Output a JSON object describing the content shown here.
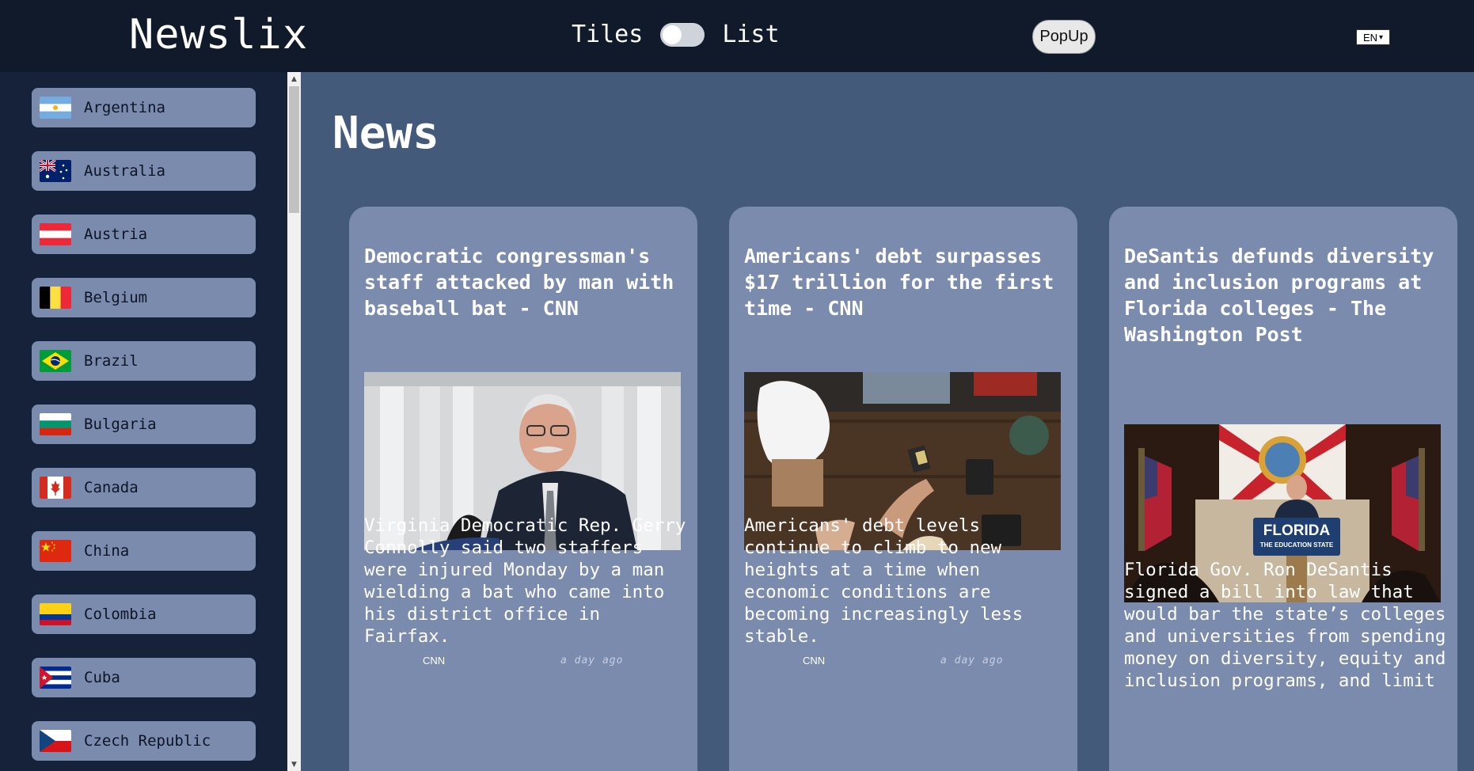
{
  "header": {
    "logo": "Newslix",
    "view_tiles": "Tiles",
    "view_list": "List",
    "popup_label": "PopUp",
    "language": "EN"
  },
  "sidebar": {
    "countries": [
      {
        "label": "Argentina",
        "flag_icon": "flag-argentina-icon"
      },
      {
        "label": "Australia",
        "flag_icon": "flag-australia-icon"
      },
      {
        "label": "Austria",
        "flag_icon": "flag-austria-icon"
      },
      {
        "label": "Belgium",
        "flag_icon": "flag-belgium-icon"
      },
      {
        "label": "Brazil",
        "flag_icon": "flag-brazil-icon"
      },
      {
        "label": "Bulgaria",
        "flag_icon": "flag-bulgaria-icon"
      },
      {
        "label": "Canada",
        "flag_icon": "flag-canada-icon"
      },
      {
        "label": "China",
        "flag_icon": "flag-china-icon"
      },
      {
        "label": "Colombia",
        "flag_icon": "flag-colombia-icon"
      },
      {
        "label": "Cuba",
        "flag_icon": "flag-cuba-icon"
      },
      {
        "label": "Czech Republic",
        "flag_icon": "flag-czech-republic-icon"
      }
    ]
  },
  "main": {
    "title": "News",
    "articles": [
      {
        "title": "Democratic congressman's staff attacked by man with baseball bat - CNN",
        "description": "Virginia Democratic Rep. Gerry Connolly said two staffers were injured Monday by a man wielding a bat who came into his district office in Fairfax.",
        "source": "CNN",
        "time": "a day ago"
      },
      {
        "title": "Americans' debt surpasses $17 trillion for the first time - CNN",
        "description": "Americans' debt levels continue to climb to new heights at a time when economic conditions are becoming increasingly less stable.",
        "source": "CNN",
        "time": "a day ago"
      },
      {
        "title": "DeSantis defunds diversity and inclusion programs at Florida colleges - The Washington Post",
        "description": "Florida Gov. Ron DeSantis signed a bill into law that would bar the state’s colleges and universities from spending money on diversity, equity and inclusion programs, and limit",
        "image_text_1": "FLORIDA",
        "image_text_2": "THE EDUCATION STATE"
      }
    ]
  },
  "colors": {
    "header_bg": "#101a2b",
    "sidebar_bg": "#16213a",
    "main_bg": "#435a7a",
    "card_bg": "#7b8bad"
  }
}
